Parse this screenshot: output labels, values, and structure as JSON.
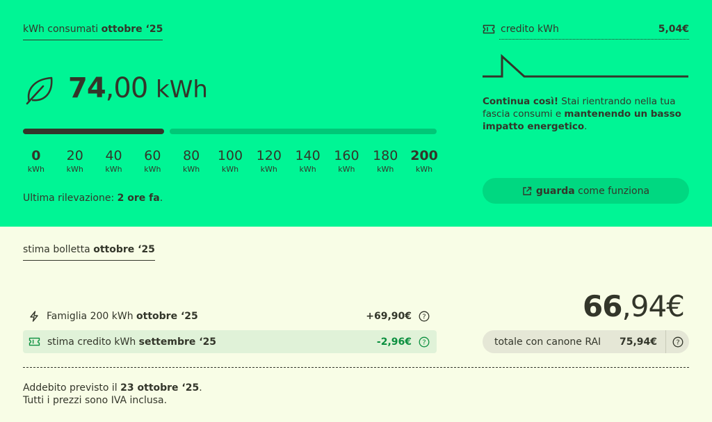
{
  "consumption": {
    "title_prefix": "kWh consumati",
    "title_period": "ottobre ‘25",
    "value_int": "74",
    "value_dec": ",00",
    "unit": "kWh",
    "progress": 0.37,
    "ticks": [
      {
        "value": "0",
        "unit": "kWh"
      },
      {
        "value": "20",
        "unit": "kWh"
      },
      {
        "value": "40",
        "unit": "kWh"
      },
      {
        "value": "60",
        "unit": "kWh"
      },
      {
        "value": "80",
        "unit": "kWh"
      },
      {
        "value": "100",
        "unit": "kWh"
      },
      {
        "value": "120",
        "unit": "kWh"
      },
      {
        "value": "140",
        "unit": "kWh"
      },
      {
        "value": "160",
        "unit": "kWh"
      },
      {
        "value": "180",
        "unit": "kWh"
      },
      {
        "value": "200",
        "unit": "kWh"
      }
    ],
    "last_reading_label": "Ultima rilevazione: ",
    "last_reading_value": "2 ore fa",
    "last_reading_suffix": "."
  },
  "credit": {
    "label": "credito kWh",
    "value": "5,04€",
    "msg_bold1": "Continua così!",
    "msg_text1": " Stai rientrando nella tua fascia consumi e ",
    "msg_bold2": "mantenendo un basso impatto energetico",
    "msg_text2": ".",
    "button_bold": "guarda",
    "button_text": " come funziona",
    "button_icon": "external-link-icon"
  },
  "estimate": {
    "title_prefix": "stima bolletta",
    "title_period": "ottobre ‘25",
    "rows": [
      {
        "icon": "lightning-icon",
        "text": "Famiglia 200 kWh",
        "period": "ottobre ‘25",
        "amount": "+69,90€"
      },
      {
        "icon": "ticket-icon",
        "text": "stima credito kWh",
        "period": "settembre ‘25",
        "amount": "-2,96€"
      }
    ],
    "total_int": "66",
    "total_dec": ",94€",
    "rai_label": "totale con canone RAI",
    "rai_value": "75,94€",
    "footer_prefix": "Addebito previsto il ",
    "footer_date": "23 ottobre ‘25",
    "footer_suffix": ".",
    "footer_line2": "Tutti i prezzi sono IVA inclusa."
  },
  "colors": {
    "accent_green": "#00f595",
    "dark": "#33362a",
    "cream": "#f8fde6",
    "credit_green": "#0b8f3f"
  }
}
